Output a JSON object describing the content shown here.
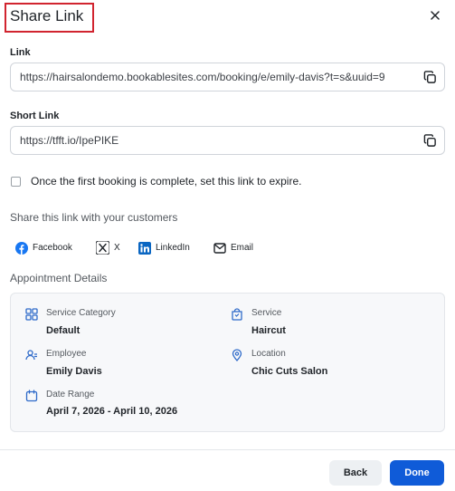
{
  "dialog": {
    "title": "Share Link"
  },
  "link": {
    "label": "Link",
    "value": "https://hairsalondemo.bookablesites.com/booking/e/emily-davis?t=s&uuid=9"
  },
  "short_link": {
    "label": "Short Link",
    "value": "https://tfft.io/IpePIKE"
  },
  "expire_option": {
    "label": "Once the first booking is complete, set this link to expire.",
    "checked": false
  },
  "share": {
    "heading": "Share this link with your customers",
    "options": [
      {
        "label": "Facebook",
        "icon": "facebook-icon"
      },
      {
        "label": "X",
        "icon": "x-icon"
      },
      {
        "label": "LinkedIn",
        "icon": "linkedin-icon"
      },
      {
        "label": "Email",
        "icon": "email-icon"
      }
    ]
  },
  "appointment": {
    "title": "Appointment Details",
    "service_category": {
      "label": "Service Category",
      "value": "Default"
    },
    "service": {
      "label": "Service",
      "value": "Haircut"
    },
    "employee": {
      "label": "Employee",
      "value": "Emily Davis"
    },
    "location": {
      "label": "Location",
      "value": "Chic Cuts Salon"
    },
    "date_range": {
      "label": "Date Range",
      "value": "April 7, 2026 - April 10, 2026"
    }
  },
  "footer": {
    "back_label": "Back",
    "done_label": "Done"
  },
  "colors": {
    "primary": "#0f5bd8",
    "facebook": "#1877f2",
    "linkedin": "#0a66c2",
    "accent_icon": "#2e6ac9",
    "highlight_border": "#d1242f"
  }
}
